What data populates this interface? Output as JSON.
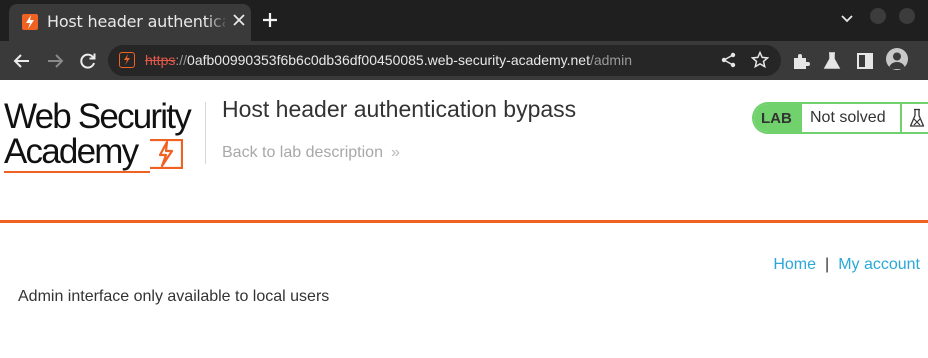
{
  "browser": {
    "tab": {
      "title": "Host header authentication bypass",
      "favicon": "lightning-bolt-icon"
    },
    "new_tab_icon": "plus-icon",
    "tabs_menu_icon": "chevron-down-icon",
    "nav": {
      "back_icon": "back-arrow-icon",
      "forward_icon": "forward-arrow-icon",
      "reload_icon": "reload-icon"
    },
    "url": {
      "scheme": "https",
      "separator": "://",
      "host": "0afb00990353f6b6c0db36df00450085.web-security-academy.net",
      "path": "/admin"
    },
    "toolbar_icons": [
      "share-icon",
      "star-icon",
      "extensions-icon",
      "flask-icon",
      "sidepanel-icon",
      "profile-icon"
    ]
  },
  "header": {
    "logo": {
      "line1": "Web Security",
      "line2": "Academy"
    },
    "lab_title": "Host header authentication bypass",
    "back_link": "Back to lab description",
    "back_link_chevron": "»",
    "lab_badge": "LAB",
    "lab_status": "Not solved"
  },
  "nav": {
    "home": "Home",
    "separator": "|",
    "my_account": "My account"
  },
  "main": {
    "message": "Admin interface only available to local users"
  },
  "colors": {
    "accent": "#f06222",
    "lab_green": "#70d16d",
    "link": "#2aa8d8",
    "text": "#333333"
  }
}
